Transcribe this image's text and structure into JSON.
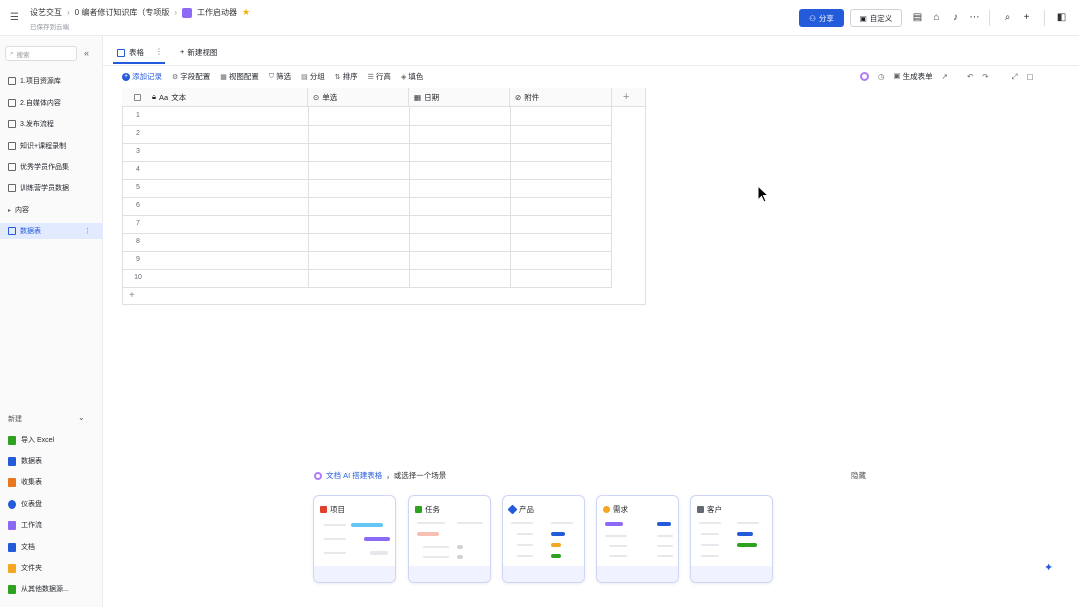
{
  "header": {
    "breadcrumbs": [
      "设艺交互",
      "0 编者修订知识库（专项版",
      "工作启动器"
    ],
    "saved_status": "已保存到云端",
    "share_label": "分享",
    "present_label": "自定义"
  },
  "sidebar": {
    "search_placeholder": "搜索",
    "items": [
      {
        "label": "1.项目资源库"
      },
      {
        "label": "2.自媒体内容"
      },
      {
        "label": "3.发布流程"
      },
      {
        "label": "知识+课程录制"
      },
      {
        "label": "优秀学员作品集"
      },
      {
        "label": "训练营学员数据"
      },
      {
        "label": "内容"
      },
      {
        "label": "数据表"
      }
    ],
    "new_header": "新建",
    "new_items": [
      {
        "label": "导入 Excel",
        "color": "#2ea121"
      },
      {
        "label": "数据表",
        "color": "#245bdb"
      },
      {
        "label": "收集表",
        "color": "#e87722"
      },
      {
        "label": "仪表盘",
        "color": "#245bdb"
      },
      {
        "label": "工作流",
        "color": "#8d6af5"
      },
      {
        "label": "文档",
        "color": "#245bdb"
      },
      {
        "label": "文件夹",
        "color": "#f5a623"
      },
      {
        "label": "从其他数据源...",
        "color": "#2ea121"
      }
    ]
  },
  "tabs": {
    "table_label": "表格",
    "add_view_label": "新建视图"
  },
  "toolbar": {
    "add_record": "添加记录",
    "field_config": "字段配置",
    "view_config": "视图配置",
    "filter": "筛选",
    "group": "分组",
    "sort": "排序",
    "row_height": "行高",
    "fill_color": "填色",
    "generate_form": "生成表单"
  },
  "grid": {
    "columns": [
      "文本",
      "单选",
      "日期",
      "附件"
    ],
    "rows": [
      "1",
      "2",
      "3",
      "4",
      "5",
      "6",
      "7",
      "8",
      "9",
      "10"
    ]
  },
  "templates": {
    "title_ai": "文档 AI 搭建表格",
    "title_rest": "，或选择一个场景",
    "hide_label": "隐藏",
    "cards": [
      {
        "label": "项目",
        "color": "#e0412b"
      },
      {
        "label": "任务",
        "color": "#2ea121"
      },
      {
        "label": "产品",
        "color": "#245bdb"
      },
      {
        "label": "需求",
        "color": "#8d6af5"
      },
      {
        "label": "客户",
        "color": "#646a73"
      }
    ]
  }
}
